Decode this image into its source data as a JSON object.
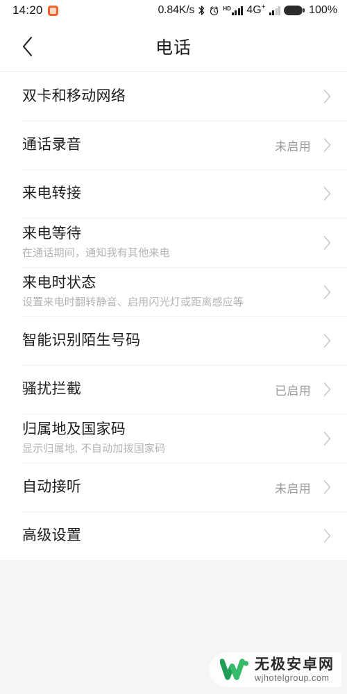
{
  "statusbar": {
    "time": "14:20",
    "app_icon": "app-badge-icon",
    "network_speed": "0.84K/s",
    "bluetooth_icon": "bluetooth-icon",
    "alarm_icon": "alarm-clock-icon",
    "hd_label": "HD",
    "signal_icon_1": "signal-bars-icon",
    "network_type": "4G",
    "network_type_sup": "+",
    "signal_icon_2": "signal-bars-icon",
    "battery_icon": "battery-full-icon",
    "battery_percent": "100%"
  },
  "header": {
    "back_icon": "back-chevron-icon",
    "title": "电话"
  },
  "list": {
    "items": [
      {
        "title": "双卡和移动网络",
        "subtitle": "",
        "value": ""
      },
      {
        "title": "通话录音",
        "subtitle": "",
        "value": "未启用"
      },
      {
        "title": "来电转接",
        "subtitle": "",
        "value": ""
      },
      {
        "title": "来电等待",
        "subtitle": "在通话期间，通知我有其他来电",
        "value": ""
      },
      {
        "title": "来电时状态",
        "subtitle": "设置来电时翻转静音、启用闪光灯或距离感应等",
        "value": ""
      },
      {
        "title": "智能识别陌生号码",
        "subtitle": "",
        "value": ""
      },
      {
        "title": "骚扰拦截",
        "subtitle": "",
        "value": "已启用"
      },
      {
        "title": "归属地及国家码",
        "subtitle": "显示归属地, 不自动加拨国家码",
        "value": ""
      },
      {
        "title": "自动接听",
        "subtitle": "",
        "value": "未启用"
      },
      {
        "title": "高级设置",
        "subtitle": "",
        "value": ""
      }
    ]
  },
  "watermark": {
    "logo_icon": "w-logo-icon",
    "site_name": "无极安卓网",
    "site_url": "wjhotelgroup.com",
    "brand_color": "#22a45d"
  }
}
